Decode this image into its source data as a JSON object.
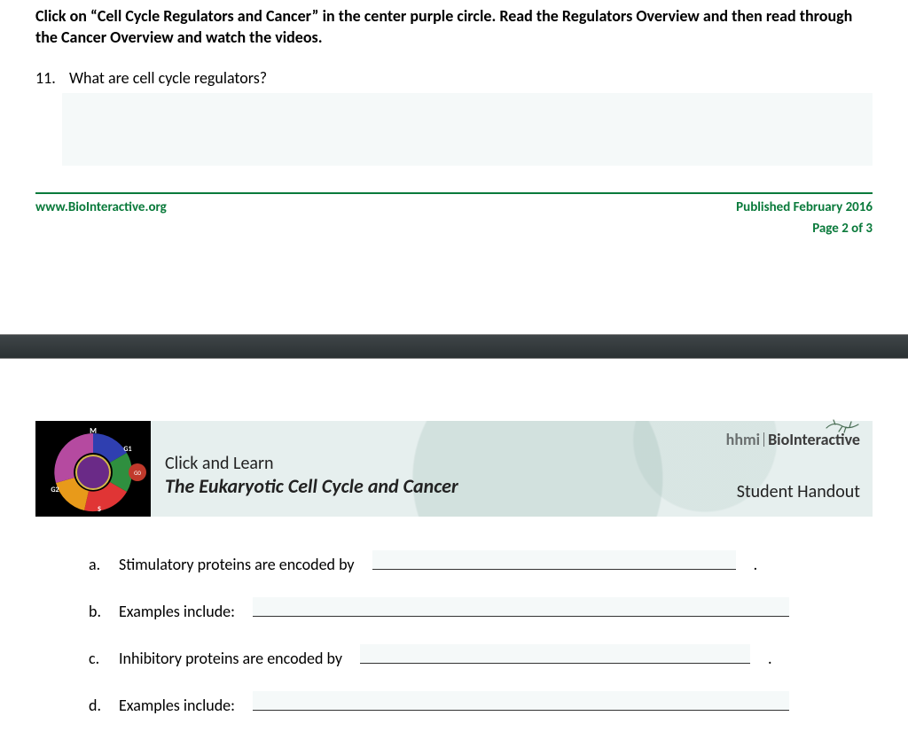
{
  "upper": {
    "instruction": "Click on “Cell Cycle Regulators and Cancer” in the center purple circle. Read the Regulators Overview and then read through the Cancer Overview and watch the videos.",
    "question_number": "11.",
    "question_text": "What are cell cycle regulators?",
    "footer_left": "www.BioInteractive.org",
    "footer_right": "Published February 2016",
    "page_num": "Page 2 of 3"
  },
  "banner": {
    "click_and_learn": "Click and Learn",
    "title": "The Eukaryotic Cell Cycle and Cancer",
    "hhmi": "hhmi",
    "bio": "BioInteractive",
    "student": "Student Handout",
    "phases": {
      "m": "M",
      "g1": "G1",
      "g0": "G0",
      "g2": "G2",
      "s": "S"
    }
  },
  "subs": {
    "a": {
      "letter": "a.",
      "text": "Stimulatory proteins are encoded by"
    },
    "b": {
      "letter": "b.",
      "text": "Examples include:"
    },
    "c": {
      "letter": "c.",
      "text": "Inhibitory proteins are encoded by"
    },
    "d": {
      "letter": "d.",
      "text": "Examples include:"
    }
  }
}
